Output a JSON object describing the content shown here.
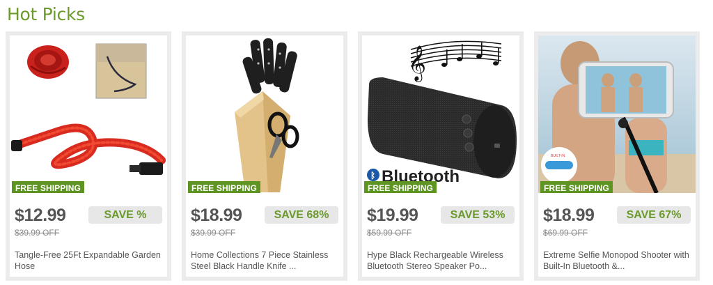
{
  "section": {
    "title": "Hot Picks"
  },
  "products": [
    {
      "badge": "FREE SHIPPING",
      "price": "$12.99",
      "old_price": "$39.99 OFF",
      "save": "SAVE %",
      "title": "Tangle-Free 25Ft Expandable Garden Hose",
      "image_icon": "garden-hose-image"
    },
    {
      "badge": "FREE SHIPPING",
      "price": "$18.99",
      "old_price": "$39.99 OFF",
      "save": "SAVE 68%",
      "title": "Home Collections 7 Piece Stainless Steel Black Handle Knife ...",
      "image_icon": "knife-block-image"
    },
    {
      "badge": "FREE SHIPPING",
      "price": "$19.99",
      "old_price": "$59.99 OFF",
      "save": "SAVE 53%",
      "title": "Hype Black Rechargeable Wireless Bluetooth Stereo Speaker Po...",
      "image_icon": "bluetooth-speaker-image",
      "image_text": "Bluetooth"
    },
    {
      "badge": "FREE SHIPPING",
      "price": "$18.99",
      "old_price": "$69.99 OFF",
      "save": "SAVE 67%",
      "title": "Extreme Selfie Monopod Shooter with Built-In Bluetooth &...",
      "image_icon": "selfie-monopod-image"
    }
  ],
  "colors": {
    "title_green": "#6d9a2d",
    "badge_green": "#5e9421",
    "save_green": "#6a9a2b",
    "card_border": "#ececec"
  }
}
